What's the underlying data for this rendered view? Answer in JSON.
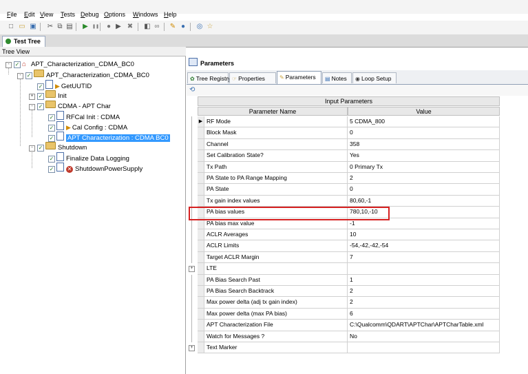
{
  "menu": {
    "items": [
      "File",
      "Edit",
      "View",
      "Tests",
      "Debug",
      "Options",
      "Windows",
      "Help"
    ],
    "accelerators": [
      "F",
      "E",
      "V",
      "T",
      "D",
      "O",
      "W",
      "H"
    ],
    "rest": [
      "ile",
      "dit",
      "iew",
      "ests",
      "ebug",
      "ptions",
      "indows",
      "elp"
    ]
  },
  "toolbar": {
    "icons": [
      "new-icon",
      "open-icon",
      "save-icon",
      "cut-icon",
      "copy-icon",
      "paste-icon",
      "run-icon",
      "pause-icon",
      "record-icon",
      "step-icon",
      "stop-icon",
      "properties-icon",
      "link-icon",
      "build-icon",
      "help-icon",
      "about-icon",
      "options-icon"
    ]
  },
  "tabs": {
    "test_tree": "Test Tree"
  },
  "tree": {
    "header": "Tree View",
    "nodes": [
      {
        "label": "APT_Characterization_CDMA_BC0",
        "expander": "-",
        "icon": "home-icon"
      },
      {
        "label": "APT_Characterization_CDMA_BC0",
        "expander": "-",
        "icon": "folder-icon"
      },
      {
        "label": "GetUUTID",
        "expander": "",
        "icon": "flag-icon"
      },
      {
        "label": "Init",
        "expander": "+",
        "icon": "folder-icon"
      },
      {
        "label": "CDMA - APT Char",
        "expander": "-",
        "icon": "folder-icon"
      },
      {
        "label": "RFCal Init : CDMA",
        "expander": "",
        "icon": "doc-icon"
      },
      {
        "label": "Cal Config : CDMA",
        "expander": "",
        "icon": "flag-icon"
      },
      {
        "label": "APT Characterization : CDMA BC0",
        "expander": "",
        "icon": "doc-icon"
      },
      {
        "label": "Shutdown",
        "expander": "-",
        "icon": "folder-icon"
      },
      {
        "label": "Finalize Data Logging",
        "expander": "",
        "icon": "doc-icon"
      },
      {
        "label": "ShutdownPowerSupply",
        "expander": "",
        "icon": "stop-icon"
      }
    ],
    "selected_index": 7,
    "check": "✓"
  },
  "panel": {
    "title": "Parameters",
    "tabs": [
      "Tree Registry",
      "Properties",
      "Parameters",
      "Notes",
      "Loop Setup"
    ],
    "active_tab": "Parameters"
  },
  "grid": {
    "group_header": "Input Parameters",
    "columns": [
      "Parameter Name",
      "Value"
    ],
    "current_row_marker": "▶",
    "rows": [
      {
        "name": "RF Mode",
        "value": "5 CDMA_800",
        "current": true
      },
      {
        "name": "Block Mask",
        "value": "0"
      },
      {
        "name": "Channel",
        "value": "358"
      },
      {
        "name": "Set Calibration State?",
        "value": "Yes"
      },
      {
        "name": "Tx Path",
        "value": "0 Primary Tx"
      },
      {
        "name": "PA State to PA Range Mapping",
        "value": "2"
      },
      {
        "name": "PA State",
        "value": "0"
      },
      {
        "name": "Tx gain index values",
        "value": "80,60,-1"
      },
      {
        "name": "PA bias values",
        "value": "780,10,-10",
        "highlighted": true
      },
      {
        "name": "PA bias max value",
        "value": "-1"
      },
      {
        "name": "ACLR Averages",
        "value": "10"
      },
      {
        "name": "ACLR Limits",
        "value": "-54,-42,-42,-54"
      },
      {
        "name": "Target ACLR Margin",
        "value": "7"
      },
      {
        "name": "LTE",
        "value": "",
        "expandable": true
      },
      {
        "name": "PA Bias Search Past",
        "value": "1"
      },
      {
        "name": "PA Bias Search Backtrack",
        "value": "2"
      },
      {
        "name": "Max power delta (adj tx gain index)",
        "value": "2"
      },
      {
        "name": "Max power delta (max PA bias)",
        "value": "6"
      },
      {
        "name": "APT Characterization File",
        "value": "C:\\Qualcomm\\QDART\\APTChar\\APTCharTable.xml"
      },
      {
        "name": "Watch for Messages ?",
        "value": "No"
      },
      {
        "name": "Text Marker",
        "value": "",
        "expandable": true
      }
    ]
  }
}
